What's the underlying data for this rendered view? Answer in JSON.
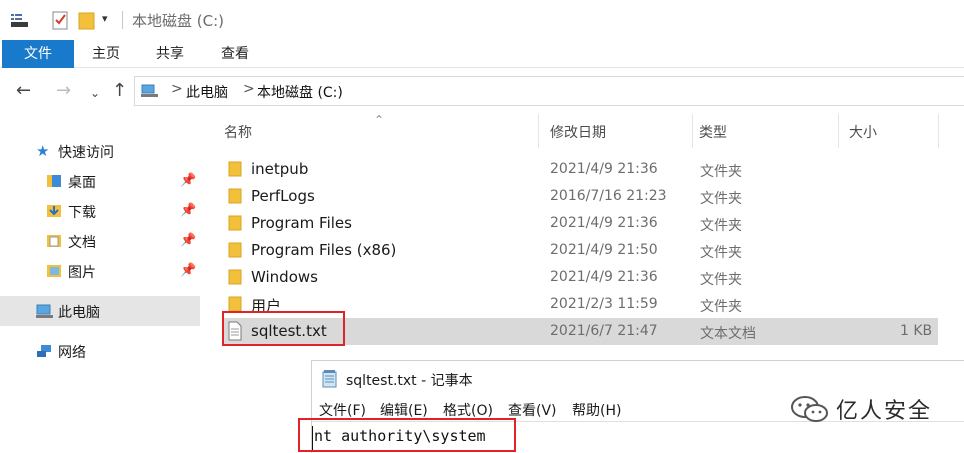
{
  "window": {
    "title": "本地磁盘 (C:)"
  },
  "ribbon": {
    "tabs": [
      "文件",
      "主页",
      "共享",
      "查看"
    ]
  },
  "address": {
    "crumbs": [
      "此电脑",
      "本地磁盘 (C:)"
    ],
    "separator": ">"
  },
  "sidebar": {
    "quick_access": "快速访问",
    "items": [
      {
        "label": "桌面",
        "icon": "desktop-icon",
        "pinned": true
      },
      {
        "label": "下载",
        "icon": "download-icon",
        "pinned": true
      },
      {
        "label": "文档",
        "icon": "document-icon",
        "pinned": true
      },
      {
        "label": "图片",
        "icon": "picture-icon",
        "pinned": true
      }
    ],
    "this_pc": "此电脑",
    "network": "网络"
  },
  "list": {
    "columns": [
      "名称",
      "修改日期",
      "类型",
      "大小"
    ],
    "rows": [
      {
        "name": "inetpub",
        "date": "2021/4/9 21:36",
        "type": "文件夹",
        "size": "",
        "kind": "folder"
      },
      {
        "name": "PerfLogs",
        "date": "2016/7/16 21:23",
        "type": "文件夹",
        "size": "",
        "kind": "folder"
      },
      {
        "name": "Program Files",
        "date": "2021/4/9 21:36",
        "type": "文件夹",
        "size": "",
        "kind": "folder"
      },
      {
        "name": "Program Files (x86)",
        "date": "2021/4/9 21:50",
        "type": "文件夹",
        "size": "",
        "kind": "folder"
      },
      {
        "name": "Windows",
        "date": "2021/4/9 21:36",
        "type": "文件夹",
        "size": "",
        "kind": "folder"
      },
      {
        "name": "用户",
        "date": "2021/2/3 11:59",
        "type": "文件夹",
        "size": "",
        "kind": "folder"
      },
      {
        "name": "sqltest.txt",
        "date": "2021/6/7 21:47",
        "type": "文本文档",
        "size": "1 KB",
        "kind": "file"
      }
    ]
  },
  "notepad": {
    "title": "sqltest.txt - 记事本",
    "menu": [
      "文件(F)",
      "编辑(E)",
      "格式(O)",
      "查看(V)",
      "帮助(H)"
    ],
    "content": "nt authority\\system"
  },
  "watermark": {
    "text": "亿人安全"
  },
  "colors": {
    "file_tab": "#1979ca",
    "highlight_box": "#e0232a",
    "selected_row": "#d9d9d9",
    "folder": "#f3c03c"
  }
}
